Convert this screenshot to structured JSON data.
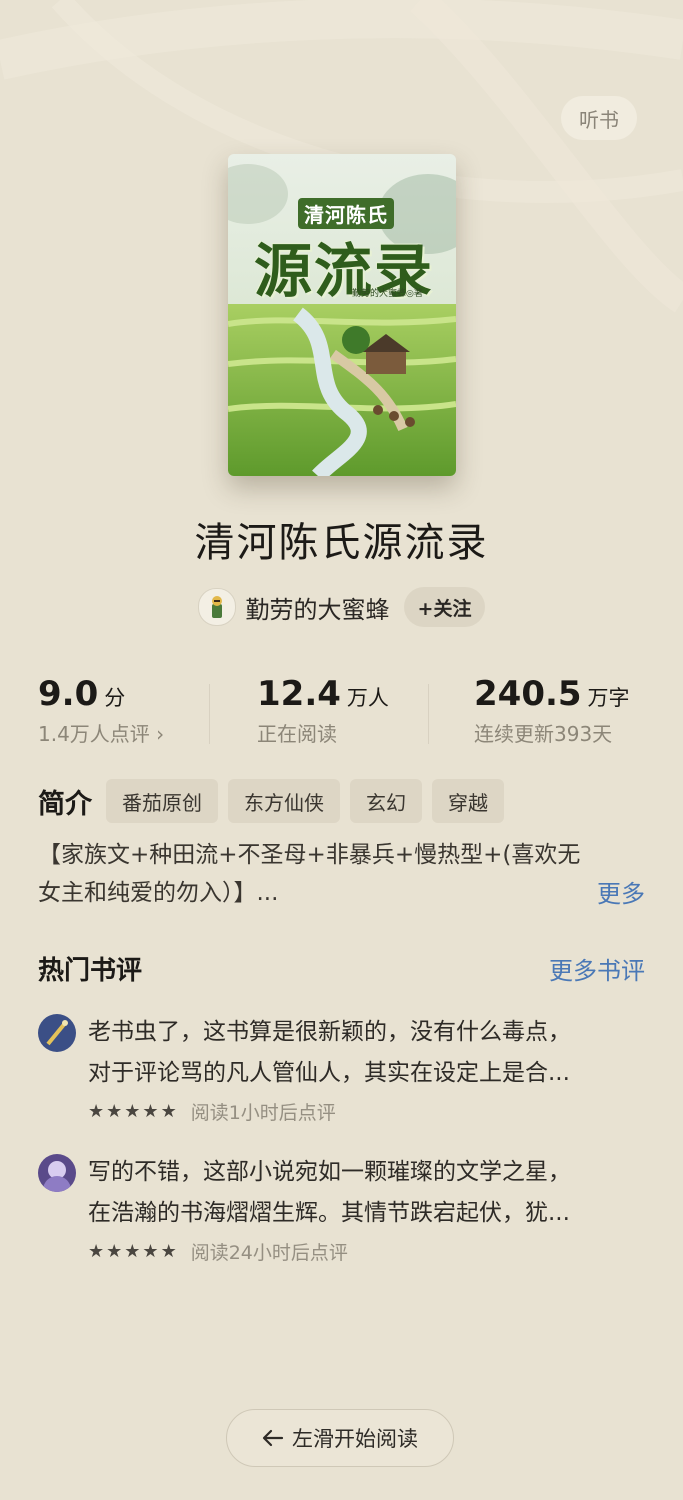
{
  "header": {
    "listen_label": "听书"
  },
  "book": {
    "cover": {
      "series_title": "清河陈氏",
      "main_title": "源流录",
      "author_caption": "勤劳的大蜜蜂◎著"
    },
    "title": "清河陈氏源流录",
    "author": "勤劳的大蜜蜂",
    "follow_label": "+关注"
  },
  "stats": {
    "score": {
      "value": "9.0",
      "unit": "分",
      "sub": "1.4万人点评 ›"
    },
    "readers": {
      "value": "12.4",
      "unit": "万人",
      "sub": "正在阅读"
    },
    "words": {
      "value": "240.5",
      "unit": "万字",
      "sub": "连续更新393天"
    }
  },
  "intro": {
    "label": "简介",
    "tags": [
      "番茄原创",
      "东方仙侠",
      "玄幻",
      "穿越"
    ],
    "line1": "【家族文+种田流+不圣母+非暴兵+慢热型+(喜欢无",
    "line2": "女主和纯爱的勿入）】...",
    "more_label": "更多"
  },
  "reviews": {
    "title": "热门书评",
    "more_label": "更多书评",
    "items": [
      {
        "line1": "老书虫了，这书算是很新颖的，没有什么毒点，",
        "line2": "对于评论骂的凡人管仙人，其实在设定上是合...",
        "stars": 5,
        "meta": "阅读1小时后点评"
      },
      {
        "line1": "写的不错，这部小说宛如一颗璀璨的文学之星，",
        "line2": "在浩瀚的书海熠熠生辉。其情节跌宕起伏，犹...",
        "stars": 5,
        "meta": "阅读24小时后点评"
      }
    ]
  },
  "footer": {
    "start_label": "左滑开始阅读",
    "start_icon": "arrow-left-icon"
  },
  "colors": {
    "background": "#e8e2d2",
    "link": "#4a78b6",
    "tag_bg": "#ddd6c5"
  }
}
